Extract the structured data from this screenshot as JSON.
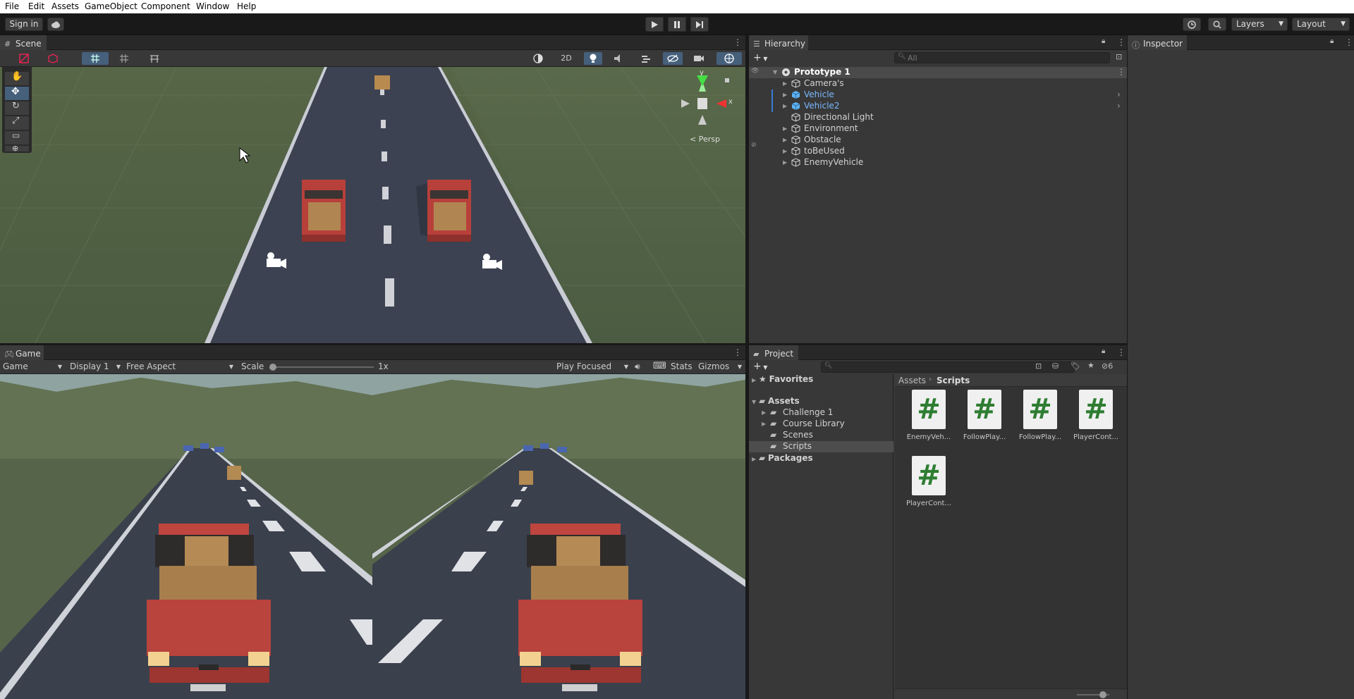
{
  "menu": [
    "File",
    "Edit",
    "Assets",
    "GameObject",
    "Component",
    "Window",
    "Help"
  ],
  "toolbar": {
    "sign_in": "Sign in",
    "layers": "Layers",
    "layout": "Layout"
  },
  "scene": {
    "tab": "Scene",
    "mode_2d": "2D",
    "gizmo_y": "y",
    "gizmo_x": "x",
    "persp": "Persp"
  },
  "hierarchy": {
    "tab": "Hierarchy",
    "search_placeholder": "All",
    "root": "Prototype 1",
    "items": [
      {
        "label": "Camera's",
        "color": "#d2d2d2"
      },
      {
        "label": "Vehicle",
        "color": "#7ab8ff"
      },
      {
        "label": "Vehicle2",
        "color": "#7ab8ff"
      },
      {
        "label": "Directional Light",
        "color": "#d2d2d2"
      },
      {
        "label": "Environment",
        "color": "#d2d2d2"
      },
      {
        "label": "Obstacle",
        "color": "#d2d2d2"
      },
      {
        "label": "toBeUsed",
        "color": "#d2d2d2"
      },
      {
        "label": "EnemyVehicle",
        "color": "#d2d2d2"
      }
    ]
  },
  "inspector": {
    "tab": "Inspector"
  },
  "game": {
    "tab": "Game",
    "view_select": "Game",
    "display": "Display 1",
    "aspect": "Free Aspect",
    "scale_label": "Scale",
    "scale_value": "1x",
    "play_mode": "Play Focused",
    "stats": "Stats",
    "gizmos": "Gizmos"
  },
  "project": {
    "tab": "Project",
    "favorites": "Favorites",
    "assets": "Assets",
    "folders": [
      "Challenge 1",
      "Course Library",
      "Scenes",
      "Scripts"
    ],
    "packages": "Packages",
    "breadcrumb": [
      "Assets",
      "Scripts"
    ],
    "hidden_count": "6",
    "files": [
      "EnemyVeh...",
      "FollowPlay...",
      "FollowPlay...",
      "PlayerCont...",
      "PlayerCont..."
    ]
  },
  "colors": {
    "selection": "#46607c",
    "accent_blue": "#7ab8ff",
    "script_green": "#2e7d32"
  }
}
